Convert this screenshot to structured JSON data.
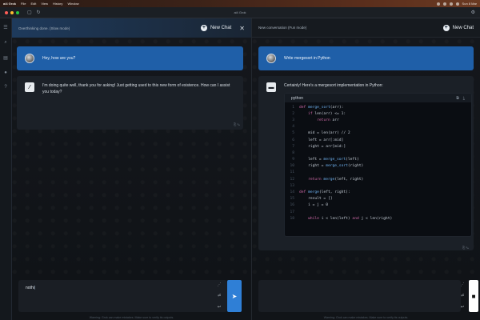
{
  "menubar": {
    "app": "ai4 Grok",
    "items": [
      "File",
      "Edit",
      "View",
      "History",
      "Window"
    ],
    "clock": "Sun 8 Mar"
  },
  "window": {
    "title": "ai4 Grok"
  },
  "left": {
    "header": "Overthinking done. (Slow mode)",
    "new_chat": "New Chat",
    "user_message": "Hey, how are you?",
    "ai_message": "I'm doing quite well, thank you for asking! Just getting used to this new form of existence. How can I assist you today?",
    "input_value": "nothi",
    "warning": "Warning: Grok can make mistakes. Make sure to verify its outputs."
  },
  "right": {
    "header": "New conversation (Fun mode)",
    "new_chat": "New Chat",
    "user_message": "Write mergesort in Python",
    "ai_message": "Certainly! Here's a mergesort implementation in Python:",
    "code_lang": "python",
    "code_lines": [
      {
        "n": "1",
        "code": "def merge_sort(arr):"
      },
      {
        "n": "2",
        "code": "    if len(arr) <= 1:"
      },
      {
        "n": "3",
        "code": "        return arr"
      },
      {
        "n": "4",
        "code": ""
      },
      {
        "n": "5",
        "code": "    mid = len(arr) // 2"
      },
      {
        "n": "6",
        "code": "    left = arr[:mid]"
      },
      {
        "n": "7",
        "code": "    right = arr[mid:]"
      },
      {
        "n": "8",
        "code": ""
      },
      {
        "n": "9",
        "code": "    left = merge_sort(left)"
      },
      {
        "n": "10",
        "code": "    right = merge_sort(right)"
      },
      {
        "n": "11",
        "code": ""
      },
      {
        "n": "12",
        "code": "    return merge(left, right)"
      },
      {
        "n": "13",
        "code": ""
      },
      {
        "n": "14",
        "code": "def merge(left, right):"
      },
      {
        "n": "15",
        "code": "    result = []"
      },
      {
        "n": "16",
        "code": "    i = j = 0"
      },
      {
        "n": "17",
        "code": ""
      },
      {
        "n": "18",
        "code": "    while i < len(left) and j < len(right)"
      }
    ],
    "input_value": "",
    "warning": "Warning: Grok can make mistakes. Make sure to verify its outputs."
  },
  "colors": {
    "accent": "#1f5fa8",
    "send": "#2f7fd6"
  }
}
